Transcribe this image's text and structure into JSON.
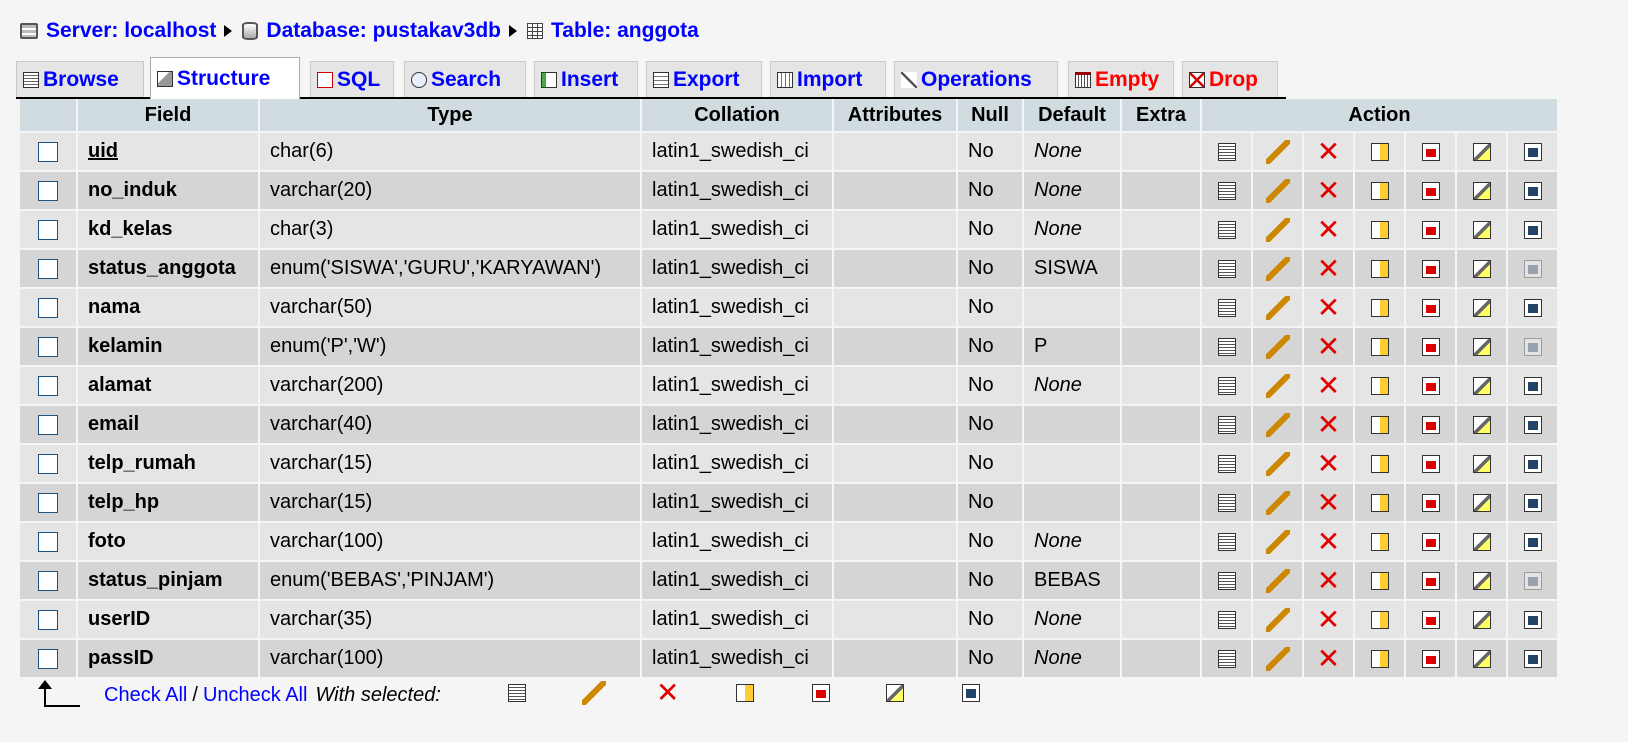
{
  "breadcrumb": {
    "server": "Server: localhost",
    "database": "Database: pustakav3db",
    "table": "Table: anggota"
  },
  "tabs": [
    {
      "label": "Browse",
      "icon": "browse-icon"
    },
    {
      "label": "Structure",
      "icon": "structure-icon",
      "active": true
    },
    {
      "label": "SQL",
      "icon": "sql-icon"
    },
    {
      "label": "Search",
      "icon": "search-icon"
    },
    {
      "label": "Insert",
      "icon": "insert-icon"
    },
    {
      "label": "Export",
      "icon": "export-icon"
    },
    {
      "label": "Import",
      "icon": "import-icon"
    },
    {
      "label": "Operations",
      "icon": "operations-icon"
    },
    {
      "label": "Empty",
      "icon": "empty-icon",
      "color": "#ff0000"
    },
    {
      "label": "Drop",
      "icon": "drop-icon",
      "color": "#ff0000"
    }
  ],
  "table": {
    "headers": {
      "field": "Field",
      "type": "Type",
      "collation": "Collation",
      "attributes": "Attributes",
      "null": "Null",
      "default": "Default",
      "extra": "Extra",
      "action": "Action"
    },
    "rows": [
      {
        "field": "uid",
        "type": "char(6)",
        "collation": "latin1_swedish_ci",
        "attributes": "",
        "null": "No",
        "default": "None",
        "default_italic": true,
        "extra": "",
        "primary": true,
        "fulltext_enabled": true
      },
      {
        "field": "no_induk",
        "type": "varchar(20)",
        "collation": "latin1_swedish_ci",
        "attributes": "",
        "null": "No",
        "default": "None",
        "default_italic": true,
        "extra": "",
        "fulltext_enabled": true
      },
      {
        "field": "kd_kelas",
        "type": "char(3)",
        "collation": "latin1_swedish_ci",
        "attributes": "",
        "null": "No",
        "default": "None",
        "default_italic": true,
        "extra": "",
        "fulltext_enabled": true
      },
      {
        "field": "status_anggota",
        "type": "enum('SISWA','GURU','KARYAWAN')",
        "collation": "latin1_swedish_ci",
        "attributes": "",
        "null": "No",
        "default": "SISWA",
        "default_italic": false,
        "extra": "",
        "fulltext_enabled": false
      },
      {
        "field": "nama",
        "type": "varchar(50)",
        "collation": "latin1_swedish_ci",
        "attributes": "",
        "null": "No",
        "default": "",
        "default_italic": false,
        "extra": "",
        "fulltext_enabled": true
      },
      {
        "field": "kelamin",
        "type": "enum('P','W')",
        "collation": "latin1_swedish_ci",
        "attributes": "",
        "null": "No",
        "default": "P",
        "default_italic": false,
        "extra": "",
        "fulltext_enabled": false
      },
      {
        "field": "alamat",
        "type": "varchar(200)",
        "collation": "latin1_swedish_ci",
        "attributes": "",
        "null": "No",
        "default": "None",
        "default_italic": true,
        "extra": "",
        "fulltext_enabled": true
      },
      {
        "field": "email",
        "type": "varchar(40)",
        "collation": "latin1_swedish_ci",
        "attributes": "",
        "null": "No",
        "default": "",
        "default_italic": false,
        "extra": "",
        "fulltext_enabled": true
      },
      {
        "field": "telp_rumah",
        "type": "varchar(15)",
        "collation": "latin1_swedish_ci",
        "attributes": "",
        "null": "No",
        "default": "",
        "default_italic": false,
        "extra": "",
        "fulltext_enabled": true
      },
      {
        "field": "telp_hp",
        "type": "varchar(15)",
        "collation": "latin1_swedish_ci",
        "attributes": "",
        "null": "No",
        "default": "",
        "default_italic": false,
        "extra": "",
        "fulltext_enabled": true
      },
      {
        "field": "foto",
        "type": "varchar(100)",
        "collation": "latin1_swedish_ci",
        "attributes": "",
        "null": "No",
        "default": "None",
        "default_italic": true,
        "extra": "",
        "fulltext_enabled": true
      },
      {
        "field": "status_pinjam",
        "type": "enum('BEBAS','PINJAM')",
        "collation": "latin1_swedish_ci",
        "attributes": "",
        "null": "No",
        "default": "BEBAS",
        "default_italic": false,
        "extra": "",
        "fulltext_enabled": false
      },
      {
        "field": "userID",
        "type": "varchar(35)",
        "collation": "latin1_swedish_ci",
        "attributes": "",
        "null": "No",
        "default": "None",
        "default_italic": true,
        "extra": "",
        "fulltext_enabled": true
      },
      {
        "field": "passID",
        "type": "varchar(100)",
        "collation": "latin1_swedish_ci",
        "attributes": "",
        "null": "No",
        "default": "None",
        "default_italic": true,
        "extra": "",
        "fulltext_enabled": true
      }
    ],
    "action_icons": [
      "browse-distinct-icon",
      "edit-icon",
      "drop-icon",
      "primary-key-icon",
      "unique-icon",
      "index-icon",
      "fulltext-icon"
    ]
  },
  "footer": {
    "check_all": "Check All",
    "separator": "/",
    "uncheck_all": "Uncheck All",
    "with_selected": "With selected:"
  },
  "colors": {
    "link": "#0000ff",
    "danger": "#ff0000",
    "header_bg": "#d0dce0",
    "row_odd": "#e5e5e5",
    "row_even": "#d5d5d5",
    "page_bg": "#f5f5f5"
  }
}
